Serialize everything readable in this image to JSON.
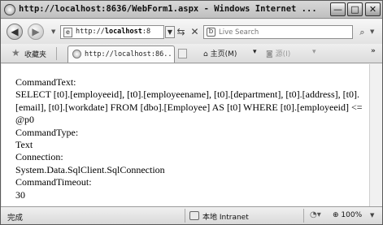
{
  "window": {
    "title": "http://localhost:8636/WebForm1.aspx - Windows Internet ...",
    "minimize": "—",
    "maximize": "□",
    "close": "✕"
  },
  "toolbar": {
    "back_icon": "back-arrow-icon",
    "forward_icon": "forward-arrow-icon",
    "address_prefix": "http://",
    "address_host": "localhost",
    "address_rest": ":8",
    "search_placeholder": "Live Search"
  },
  "tabs": {
    "favorites_label": "收藏夹",
    "active_tab_label": "http://localhost:86...",
    "home_label": "主页(M)",
    "feeds_label": "源(I)"
  },
  "content": {
    "lines": [
      "CommandText:",
      "SELECT [t0].[employeeid], [t0].[employeename], [t0].[department], [t0].[address], [t0].[email], [t0].[workdate] FROM [dbo].[Employee] AS [t0] WHERE [t0].[employeeid] <= @p0",
      "CommandType:",
      "Text",
      "Connection:",
      "System.Data.SqlClient.SqlConnection",
      "CommandTimeout:",
      "30"
    ]
  },
  "status": {
    "left_text": "完成",
    "zone_text": "本地 Intranet",
    "zoom_text": "100%"
  },
  "colors": {
    "window_frame": "#5a5a5a",
    "chrome": "#ececec",
    "content_bg": "#ffffff",
    "text": "#000000"
  }
}
